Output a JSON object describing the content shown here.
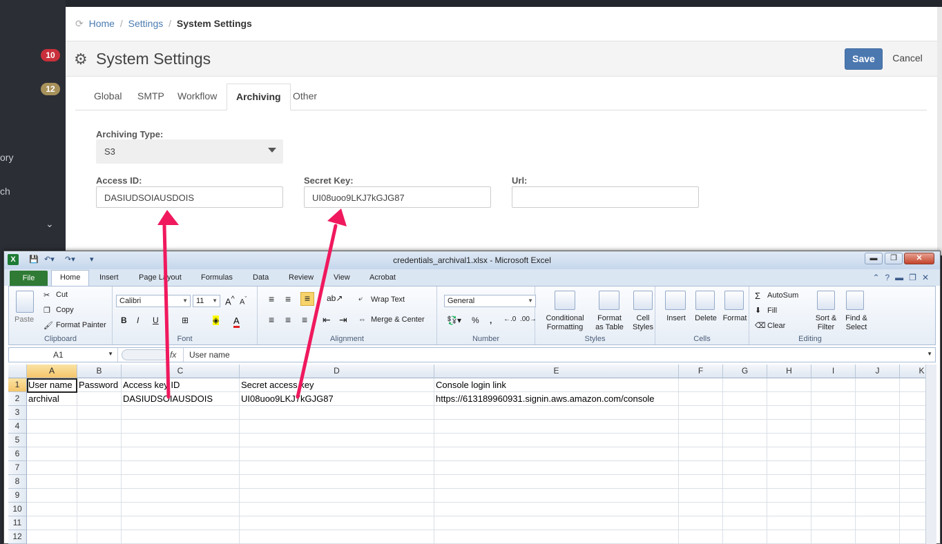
{
  "sidebar": {
    "badge_red": "10",
    "badge_gold": "12",
    "fragment_1": "ory",
    "fragment_2": "ch",
    "chevron": "⌄"
  },
  "breadcrumb": {
    "home": "Home",
    "settings": "Settings",
    "current": "System Settings",
    "separator": "/"
  },
  "header": {
    "title": "System Settings",
    "save_label": "Save",
    "cancel_label": "Cancel",
    "accent_color": "#4c78b0"
  },
  "tabs": [
    "Global",
    "SMTP",
    "Workflow",
    "Archiving",
    "Other"
  ],
  "form": {
    "archiving_type_label": "Archiving Type:",
    "archiving_type_value": "S3",
    "access_id_label": "Access ID:",
    "access_id_value": "DASIUDSOIAUSDOIS",
    "secret_key_label": "Secret Key:",
    "secret_key_value": "UI08uoo9LKJ7kGJG87",
    "url_label": "Url:",
    "url_value": ""
  },
  "excel": {
    "title": "credentials_archival1.xlsx  -  Microsoft Excel",
    "menu_tabs": [
      "File",
      "Home",
      "Insert",
      "Page Layout",
      "Formulas",
      "Data",
      "Review",
      "View",
      "Acrobat"
    ],
    "ribbon": {
      "clipboard": {
        "paste": "Paste",
        "cut": "Cut",
        "copy": "Copy",
        "format_painter": "Format Painter",
        "group": "Clipboard"
      },
      "font": {
        "family": "Calibri",
        "size": "11",
        "group": "Font"
      },
      "alignment": {
        "wrap_text": "Wrap Text",
        "merge_center": "Merge & Center",
        "group": "Alignment"
      },
      "number": {
        "format": "General",
        "group": "Number"
      },
      "styles": {
        "conditional": "Conditional",
        "conditional_2": "Formatting",
        "format_as": "Format",
        "format_as_2": "as Table",
        "cell": "Cell",
        "cell_2": "Styles",
        "group": "Styles"
      },
      "cells": {
        "insert": "Insert",
        "delete": "Delete",
        "format": "Format",
        "group": "Cells"
      },
      "editing": {
        "autosum": "AutoSum",
        "fill": "Fill",
        "clear": "Clear",
        "sort": "Sort &",
        "sort_2": "Filter",
        "find": "Find &",
        "find_2": "Select",
        "group": "Editing"
      }
    },
    "name_box": "A1",
    "formula_content": "User name",
    "columns": [
      "A",
      "B",
      "C",
      "D",
      "E",
      "F",
      "G",
      "H",
      "I",
      "J",
      "K"
    ],
    "rows": [
      "1",
      "2",
      "3",
      "4",
      "5",
      "6",
      "7",
      "8",
      "9",
      "10",
      "11",
      "12"
    ],
    "cells": {
      "A1": "User name",
      "B1": "Password",
      "C1": "Access key ID",
      "D1": "Secret access key",
      "E1": "Console login link",
      "A2": "archival",
      "C2": "DASIUDSOIAUSDOIS",
      "D2": "UI08uoo9LKJ7kGJG87",
      "E2": "https://613189960931.signin.aws.amazon.com/console"
    }
  },
  "annotation_color": "#f0195e"
}
